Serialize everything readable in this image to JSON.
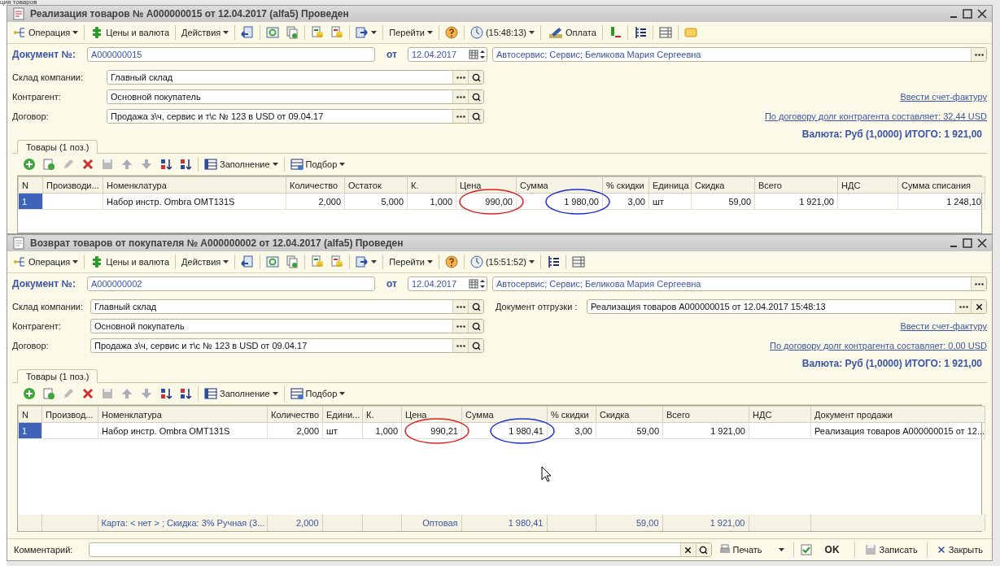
{
  "background_title": "ция товаров",
  "windows": [
    {
      "title": "Реализация товаров № A000000015 от 12.04.2017 (alfa5) Проведен",
      "toolbar": [
        {
          "kind": "button",
          "label": "Операция",
          "caret": true
        },
        {
          "kind": "separator"
        },
        {
          "kind": "button",
          "label": "Цены и валюта",
          "caret": false
        },
        {
          "kind": "separator"
        },
        {
          "kind": "button",
          "label": "Действия",
          "caret": true
        },
        {
          "kind": "separator"
        },
        {
          "kind": "button",
          "caret": false
        },
        {
          "kind": "separator"
        },
        {
          "kind": "button",
          "caret": false
        },
        {
          "kind": "button",
          "caret": false
        },
        {
          "kind": "separator"
        },
        {
          "kind": "button",
          "caret": false
        },
        {
          "kind": "button",
          "caret": false
        },
        {
          "kind": "separator"
        },
        {
          "kind": "button",
          "caret": true
        },
        {
          "kind": "separator"
        },
        {
          "kind": "button",
          "label": "Перейти",
          "caret": true
        },
        {
          "kind": "separator"
        },
        {
          "kind": "button",
          "caret": false
        },
        {
          "kind": "separator"
        },
        {
          "kind": "button",
          "label": "(15:48:13)",
          "caret": true
        },
        {
          "kind": "separator"
        },
        {
          "kind": "button",
          "label": "Оплата",
          "caret": false
        },
        {
          "kind": "separator"
        },
        {
          "kind": "button",
          "caret": false
        },
        {
          "kind": "separator"
        },
        {
          "kind": "button",
          "caret": false
        },
        {
          "kind": "separator"
        },
        {
          "kind": "button",
          "caret": false
        },
        {
          "kind": "separator"
        },
        {
          "kind": "button",
          "caret": false
        }
      ],
      "document": {
        "label": "Документ №:",
        "number": "A000000015",
        "date_label": "от",
        "date": "12.04.2017",
        "organization": "Автосервис; Сервис; Беликова Мария Сергеевна"
      },
      "fields": [
        {
          "label": "Склад компании:",
          "value": "Главный склад"
        },
        {
          "label": "Контрагент:",
          "value": "Основной покупатель"
        },
        {
          "label": "Договор:",
          "value": "Продажа з\\ч, сервис и т\\с № 123 в USD от 09.04.17"
        }
      ],
      "links": [
        "Ввести счет-фактуру",
        "По договору долг контрагента составляет: 32,44 USD"
      ],
      "total": "Валюта: Руб (1,0000) ИТОГО: 1 921,00",
      "tabs": [
        {
          "label": "Товары (1 поз.)",
          "selected": true
        }
      ],
      "table_toolbar": [
        {
          "kind": "button",
          "caret": false
        },
        {
          "kind": "button",
          "caret": false
        },
        {
          "kind": "button",
          "caret": false
        },
        {
          "kind": "button",
          "caret": false
        },
        {
          "kind": "button",
          "caret": false
        },
        {
          "kind": "button",
          "caret": false
        },
        {
          "kind": "button",
          "caret": false
        },
        {
          "kind": "button",
          "caret": false
        },
        {
          "kind": "button",
          "caret": false
        },
        {
          "kind": "separator"
        },
        {
          "kind": "button",
          "label": "Заполнение",
          "caret": true
        },
        {
          "kind": "separator"
        },
        {
          "kind": "button",
          "label": "Подбор",
          "caret": true
        }
      ],
      "table": {
        "columns": [
          "N",
          "Производи...",
          "Номенклатура",
          "Количество",
          "Остаток",
          "К.",
          "Цена",
          "Сумма",
          "% скидки",
          "Единица",
          "Скидка",
          "Всего",
          "НДС",
          "Сумма списания"
        ],
        "rows": [
          {
            "selected": true,
            "cells": [
              "1",
              {
                "kind": "empty"
              },
              "Набор инстр. Ombra OMT131S",
              "2,000",
              "5,000",
              "1,000",
              {
                "text": "990,00",
                "color": "#e02020"
              },
              {
                "text": "1 980,00",
                "color": "#2030d0"
              },
              "3,00",
              "шт",
              "59,00",
              "1 921,00",
              {
                "kind": "empty"
              },
              "1 248,10"
            ]
          }
        ]
      }
    },
    {
      "title": "Возврат товаров от покупателя № A000000002 от 12.04.2017 (alfa5) Проведен",
      "toolbar": [
        {
          "kind": "button",
          "label": "Операция",
          "caret": true
        },
        {
          "kind": "separator"
        },
        {
          "kind": "button",
          "label": "Цены и валюта",
          "caret": false
        },
        {
          "kind": "separator"
        },
        {
          "kind": "button",
          "label": "Действия",
          "caret": true
        },
        {
          "kind": "separator"
        },
        {
          "kind": "button",
          "caret": false
        },
        {
          "kind": "separator"
        },
        {
          "kind": "button",
          "caret": false
        },
        {
          "kind": "button",
          "caret": false
        },
        {
          "kind": "separator"
        },
        {
          "kind": "button",
          "caret": false
        },
        {
          "kind": "button",
          "caret": false
        },
        {
          "kind": "separator"
        },
        {
          "kind": "button",
          "caret": true
        },
        {
          "kind": "separator"
        },
        {
          "kind": "button",
          "label": "Перейти",
          "caret": true
        },
        {
          "kind": "separator"
        },
        {
          "kind": "button",
          "caret": false
        },
        {
          "kind": "separator"
        },
        {
          "kind": "button",
          "label": "(15:51:52)",
          "caret": true
        },
        {
          "kind": "separator"
        },
        {
          "kind": "button",
          "caret": false
        },
        {
          "kind": "separator"
        },
        {
          "kind": "button",
          "caret": false
        }
      ],
      "document": {
        "label": "Документ №:",
        "number": "A000000002",
        "date_label": "от",
        "date": "12.04.2017",
        "organization": "Автосервис; Сервис; Беликова Мария Сергеевна"
      },
      "fields": [
        {
          "label": "Склад компании:",
          "value": "Главный склад"
        },
        {
          "label": "Контрагент:",
          "value": "Основной покупатель"
        },
        {
          "label": "Договор:",
          "value": "Продажа з\\ч, сервис и т\\с № 123 в USD от 09.04.17"
        }
      ],
      "shipment": {
        "label": "Документ отгрузки :",
        "value": "Реализация товаров A000000015 от 12.04.2017 15:48:13"
      },
      "links": [
        "Ввести счет-фактуру",
        "По договору долг контрагента составляет: 0,00 USD"
      ],
      "total": "Валюта: Руб (1,0000) ИТОГО: 1 921,00",
      "tabs": [
        {
          "label": "Товары (1 поз.)",
          "selected": true
        }
      ],
      "table_toolbar": [
        {
          "kind": "button",
          "caret": false
        },
        {
          "kind": "button",
          "caret": false
        },
        {
          "kind": "button",
          "caret": false
        },
        {
          "kind": "button",
          "caret": false
        },
        {
          "kind": "button",
          "caret": false
        },
        {
          "kind": "button",
          "caret": false
        },
        {
          "kind": "button",
          "caret": false
        },
        {
          "kind": "button",
          "caret": false
        },
        {
          "kind": "button",
          "caret": false
        },
        {
          "kind": "separator"
        },
        {
          "kind": "button",
          "label": "Заполнение",
          "caret": true
        },
        {
          "kind": "separator"
        },
        {
          "kind": "button",
          "label": "Подбор",
          "caret": true
        }
      ],
      "table": {
        "columns": [
          "N",
          "Производ...",
          "Номенклатура",
          "Количество",
          "Едини...",
          "К.",
          "Цена",
          "Сумма",
          "% скидки",
          "Скидка",
          "Всего",
          "НДС",
          "Документ продажи"
        ],
        "rows": [
          {
            "selected": true,
            "cells": [
              "1",
              {
                "kind": "empty"
              },
              "Набор инстр. Ombra OMT131S",
              "2,000",
              "шт",
              "1,000",
              {
                "text": "990,21",
                "color": "#e02020"
              },
              {
                "text": "1 980,41",
                "color": "#2030d0"
              },
              "3,00",
              "59,00",
              "1 921,00",
              {
                "kind": "empty"
              },
              "Реализация товаров A000000015 от 12..."
            ]
          }
        ],
        "totals": [
          {
            "kind": "empty"
          },
          {
            "kind": "empty"
          },
          "Карта: < нет > ; Скидка: 3% Ручная (3...",
          "2,000",
          {
            "kind": "empty"
          },
          {
            "kind": "empty"
          },
          "Оптовая",
          "1 980,41",
          {
            "kind": "empty"
          },
          "59,00",
          "1 921,00",
          {
            "kind": "empty"
          },
          {
            "kind": "empty"
          }
        ]
      },
      "footer": {
        "comment_label": "Комментарий:",
        "print": "Печать",
        "ok": "OK",
        "save": "Записать",
        "close": "Закрыть"
      }
    }
  ]
}
